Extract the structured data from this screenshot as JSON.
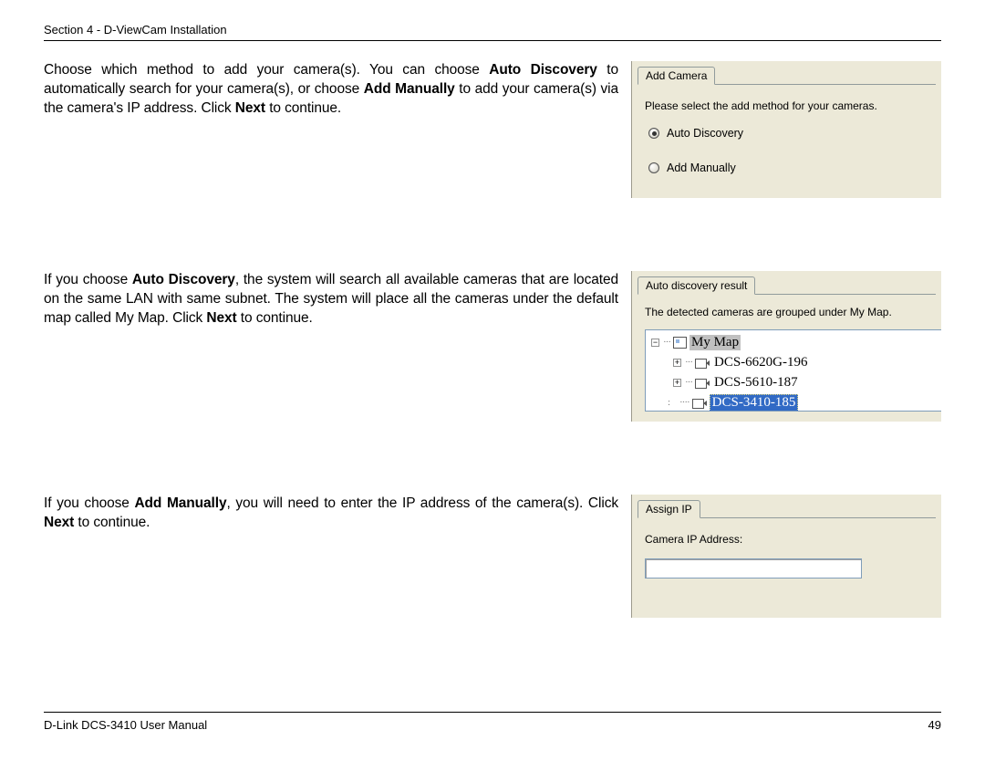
{
  "header": {
    "section": "Section 4 - D-ViewCam Installation"
  },
  "para1": {
    "t1": "Choose which method to add your camera(s). You can choose ",
    "b1": "Auto Discovery",
    "t2": " to automatically search for your camera(s), or choose ",
    "b2": "Add Manually",
    "t3": " to add your camera(s) via the camera's IP address. Click ",
    "b3": "Next",
    "t4": " to continue."
  },
  "panel1": {
    "tab": "Add Camera",
    "prompt": "Please select the add method for your cameras.",
    "opt1": "Auto Discovery",
    "opt2": "Add Manually"
  },
  "para2": {
    "t1": "If you choose ",
    "b1": "Auto Discovery",
    "t2": ", the system will search all available cameras that are located on the same LAN with same subnet. The system will place all the cameras under the default map called My Map. Click ",
    "b2": "Next",
    "t3": " to continue."
  },
  "panel2": {
    "tab": "Auto discovery result",
    "prompt": "The detected cameras are grouped under My Map.",
    "tree": {
      "root": "My Map",
      "items": [
        "DCS-6620G-196",
        "DCS-5610-187",
        "DCS-3410-185"
      ]
    }
  },
  "para3": {
    "t1": "If you choose ",
    "b1": "Add Manually",
    "t2": ", you will need to enter the IP address of the camera(s). Click ",
    "b2": "Next",
    "t3": " to continue."
  },
  "panel3": {
    "tab": "Assign IP",
    "label": "Camera IP Address:"
  },
  "footer": {
    "left": "D-Link DCS-3410 User Manual",
    "right": "49"
  }
}
